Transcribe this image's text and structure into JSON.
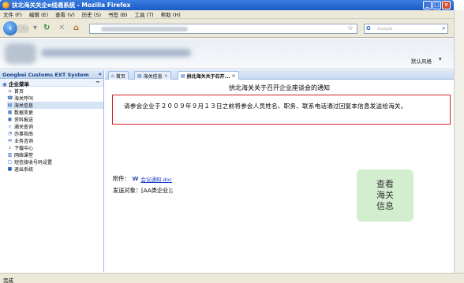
{
  "window": {
    "title": "扶北海关关企e线通系统 - Mozilla Firefox",
    "buttons": [
      "_",
      "□",
      "×"
    ]
  },
  "menu": [
    "文件 (F)",
    "编辑 (E)",
    "查看 (V)",
    "历史 (S)",
    "书签 (B)",
    "工具 (T)",
    "帮助 (H)"
  ],
  "navbar": {
    "search_placeholder": "Google"
  },
  "banner": {
    "skin_label": "默认风格"
  },
  "sidebar": {
    "header": "Gongbei Customs EXT System",
    "section": "企业菜单",
    "items": [
      {
        "label": "首页",
        "icon": "home-icon"
      },
      {
        "label": "海关呼叫",
        "icon": "call-icon"
      },
      {
        "label": "海关信息",
        "icon": "info-icon",
        "selected": true
      },
      {
        "label": "数据变更",
        "icon": "data-change-icon"
      },
      {
        "label": "资料报送",
        "icon": "upload-icon"
      },
      {
        "label": "通关查询",
        "icon": "query-icon"
      },
      {
        "label": "办事指南",
        "icon": "guide-icon"
      },
      {
        "label": "业务咨询",
        "icon": "consult-icon"
      },
      {
        "label": "下载中心",
        "icon": "download-icon"
      },
      {
        "label": "网络课堂",
        "icon": "classroom-icon"
      },
      {
        "label": "短信接收号码设置",
        "icon": "sms-icon"
      },
      {
        "label": "退出系统",
        "icon": "exit-icon"
      }
    ]
  },
  "tabs": [
    {
      "label": "首页",
      "closable": false,
      "active": false
    },
    {
      "label": "海关信息",
      "closable": true,
      "active": false
    },
    {
      "label": "拱北海关关于召开...",
      "closable": true,
      "active": true
    }
  ],
  "notice": {
    "title": "拱北海关关于召开企业座谈会的通知",
    "body": "请参会企业于２００９年９月１３日之前将参会人员姓名、职务、联系电话通过回复本信息发送给海关。",
    "attachment_label": "附件：",
    "attachment_file": "会议通知.doc",
    "send_to": "发送对象：[AA类企业]；",
    "view_button": "查看海关信息"
  },
  "status": {
    "text": "完成"
  }
}
